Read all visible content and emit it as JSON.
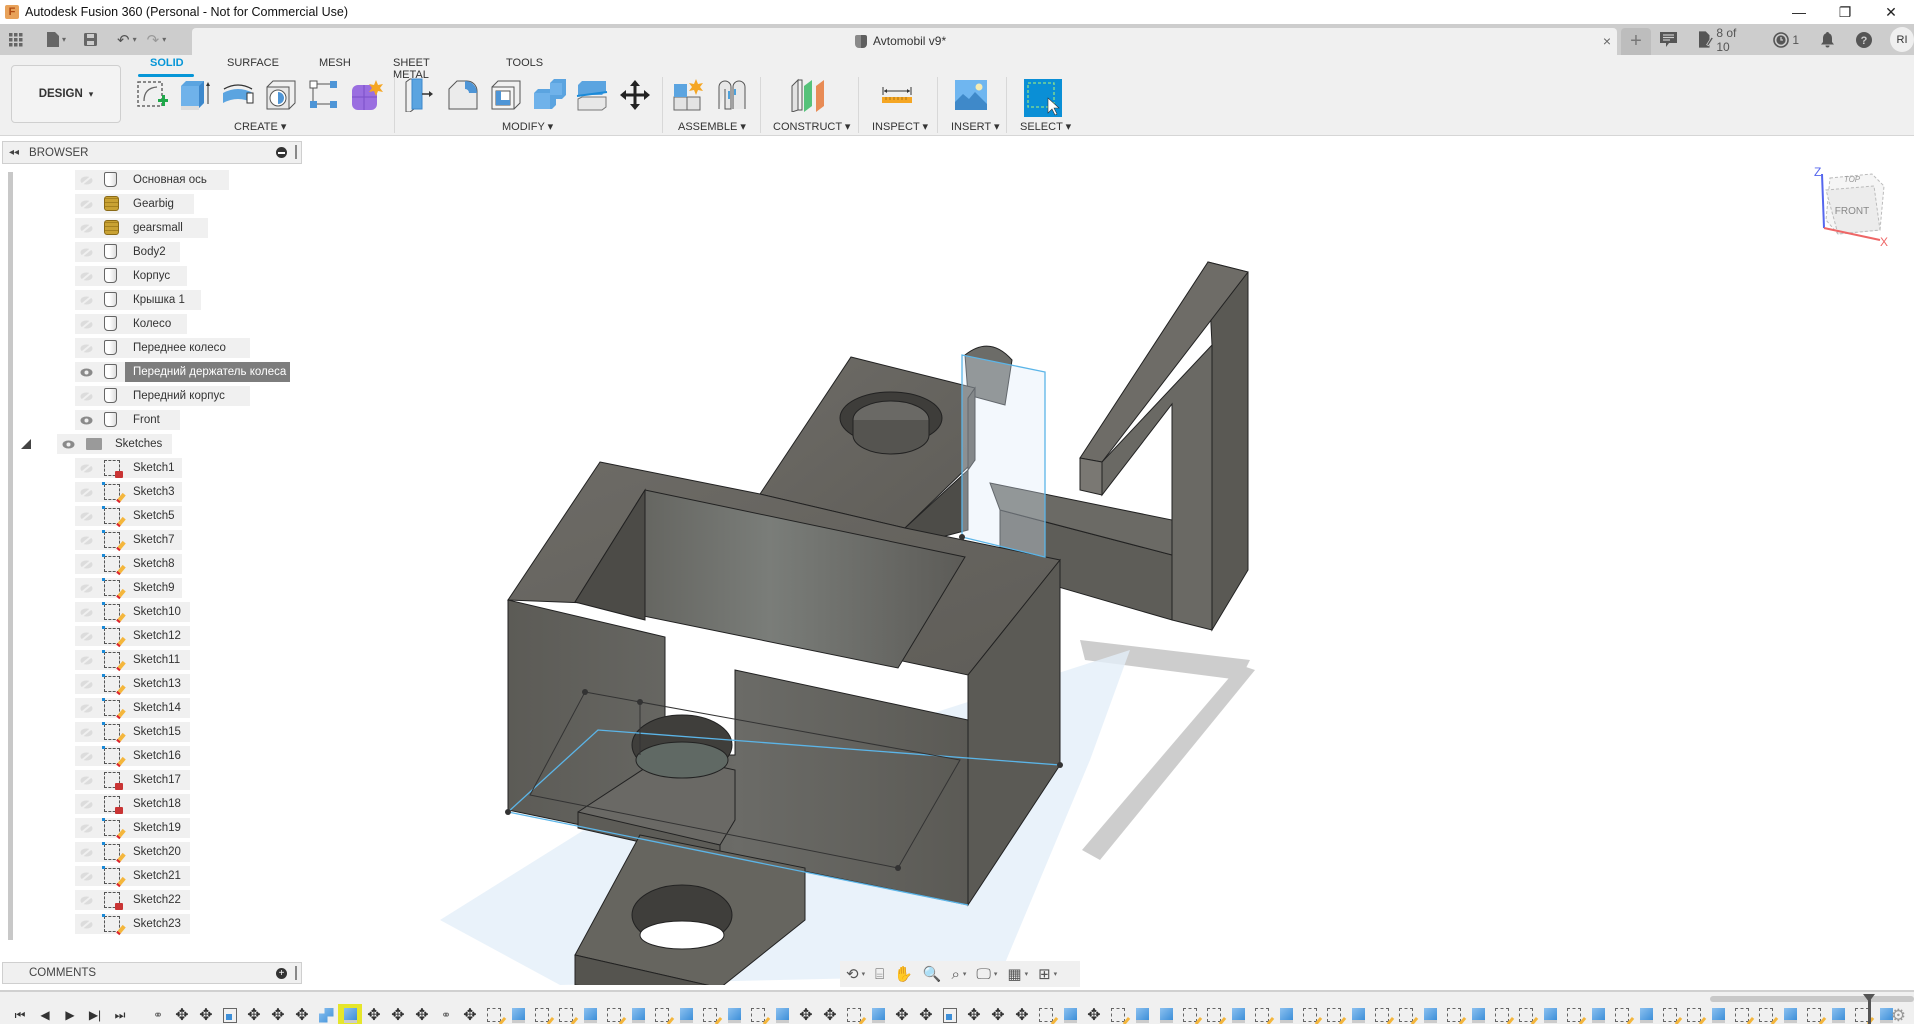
{
  "window": {
    "app_title": "Autodesk Fusion 360 (Personal - Not for Commercial Use)",
    "app_logo": "F",
    "controls": {
      "minimize": "—",
      "restore": "❐",
      "close": "✕"
    }
  },
  "tabbar": {
    "quick_access": [
      {
        "name": "data-panel-icon",
        "glyph": "▦"
      },
      {
        "name": "file-menu-icon",
        "glyph": "▮",
        "caret": "▾"
      },
      {
        "name": "save-icon",
        "glyph": "💾"
      },
      {
        "name": "undo-icon",
        "glyph": "↶",
        "caret": "▾"
      },
      {
        "name": "redo-icon",
        "glyph": "↷",
        "caret": "▾"
      }
    ],
    "document_tab": {
      "title": "Avtomobil v9*",
      "close": "×"
    },
    "new_tab": "+",
    "right": {
      "comments_glyph": "▤",
      "jobs_label": "8 of 10",
      "jobs_glyph": "✎",
      "clock_label": "1",
      "clock_glyph": "◷",
      "bell_glyph": "🔔",
      "help_glyph": "?",
      "user_initials": "RI"
    }
  },
  "ribbon": {
    "workspace": "DESIGN",
    "workspace_caret": "▾",
    "tabs": [
      {
        "label": "SOLID",
        "active": true
      },
      {
        "label": "SURFACE",
        "active": false
      },
      {
        "label": "MESH",
        "active": false
      },
      {
        "label": "SHEET METAL",
        "active": false
      },
      {
        "label": "TOOLS",
        "active": false
      }
    ],
    "groups": [
      {
        "label": "CREATE ▾"
      },
      {
        "label": "MODIFY ▾"
      },
      {
        "label": "ASSEMBLE ▾"
      },
      {
        "label": "CONSTRUCT ▾"
      },
      {
        "label": "INSPECT ▾"
      },
      {
        "label": "INSERT ▾"
      },
      {
        "label": "SELECT ▾"
      }
    ],
    "accent": "#0696d7"
  },
  "browser": {
    "title": "BROWSER",
    "collapse_glyph": "◂◂",
    "bodies": [
      {
        "label": "Основная ось",
        "visible": false,
        "icon": "body"
      },
      {
        "label": "Gearbig",
        "visible": false,
        "icon": "gear"
      },
      {
        "label": "gearsmall",
        "visible": false,
        "icon": "gear"
      },
      {
        "label": "Body2",
        "visible": false,
        "icon": "body"
      },
      {
        "label": "Корпус",
        "visible": false,
        "icon": "body"
      },
      {
        "label": "Крышка 1",
        "visible": false,
        "icon": "body"
      },
      {
        "label": "Колесо",
        "visible": false,
        "icon": "body"
      },
      {
        "label": "Переднее колесо",
        "visible": false,
        "icon": "body"
      },
      {
        "label": "Передний держатель колеса",
        "visible": true,
        "icon": "body",
        "selected": true
      },
      {
        "label": "Передний корпус",
        "visible": false,
        "icon": "body"
      },
      {
        "label": "Front",
        "visible": true,
        "icon": "body"
      }
    ],
    "sketches_folder": {
      "label": "Sketches",
      "visible": true
    },
    "sketches": [
      {
        "label": "Sketch1",
        "locked": true
      },
      {
        "label": "Sketch3",
        "locked": false
      },
      {
        "label": "Sketch5",
        "locked": false
      },
      {
        "label": "Sketch7",
        "locked": false
      },
      {
        "label": "Sketch8",
        "locked": false
      },
      {
        "label": "Sketch9",
        "locked": false
      },
      {
        "label": "Sketch10",
        "locked": false
      },
      {
        "label": "Sketch12",
        "locked": false
      },
      {
        "label": "Sketch11",
        "locked": false
      },
      {
        "label": "Sketch13",
        "locked": false
      },
      {
        "label": "Sketch14",
        "locked": false
      },
      {
        "label": "Sketch15",
        "locked": false
      },
      {
        "label": "Sketch16",
        "locked": false
      },
      {
        "label": "Sketch17",
        "locked": true
      },
      {
        "label": "Sketch18",
        "locked": true
      },
      {
        "label": "Sketch19",
        "locked": false
      },
      {
        "label": "Sketch20",
        "locked": false
      },
      {
        "label": "Sketch21",
        "locked": false
      },
      {
        "label": "Sketch22",
        "locked": true
      },
      {
        "label": "Sketch23",
        "locked": false
      }
    ]
  },
  "comments": {
    "title": "COMMENTS",
    "add_glyph": "+"
  },
  "viewcube": {
    "top": "TOP",
    "front": "FRONT",
    "axis_z": "Z",
    "axis_x": "X"
  },
  "navbar": [
    {
      "name": "orbit-icon",
      "glyph": "⟲",
      "caret": true
    },
    {
      "name": "look-at-icon",
      "glyph": "⌸",
      "caret": false
    },
    {
      "name": "pan-icon",
      "glyph": "✋",
      "caret": false
    },
    {
      "name": "zoom-icon",
      "glyph": "🔍",
      "caret": false
    },
    {
      "name": "fit-icon",
      "glyph": "⌕",
      "caret": true
    },
    {
      "name": "display-settings-icon",
      "glyph": "🖵",
      "caret": true
    },
    {
      "name": "grid-icon",
      "glyph": "▦",
      "caret": true
    },
    {
      "name": "viewports-icon",
      "glyph": "⊞",
      "caret": true
    }
  ],
  "timeline": {
    "controls": [
      "⏮",
      "◀",
      "▶",
      "▶|",
      "⏭"
    ],
    "items": [
      "joint",
      "move",
      "move",
      "shell",
      "move",
      "move",
      "move",
      "combine",
      "extrude-active",
      "move",
      "move",
      "move",
      "joint",
      "move",
      "sketch",
      "extrude",
      "sketch",
      "sketch",
      "extrude",
      "sketch",
      "extrude",
      "sketch",
      "extrude",
      "sketch",
      "extrude",
      "sketch",
      "extrude",
      "move",
      "move",
      "sketch",
      "extrude",
      "move",
      "move",
      "shell",
      "move",
      "move",
      "move",
      "sketch",
      "extrude",
      "move",
      "sketch",
      "extrude",
      "extrude",
      "sketch",
      "sketch",
      "extrude",
      "sketch",
      "extrude",
      "sketch",
      "sketch",
      "extrude",
      "sketch",
      "sketch",
      "extrude",
      "sketch",
      "extrude",
      "sketch",
      "sketch",
      "extrude",
      "sketch",
      "extrude",
      "sketch",
      "extrude",
      "sketch",
      "sketch",
      "extrude",
      "sketch",
      "sketch",
      "extrude",
      "sketch",
      "extrude",
      "sketch",
      "extrude"
    ],
    "settings_glyph": "⚙"
  }
}
